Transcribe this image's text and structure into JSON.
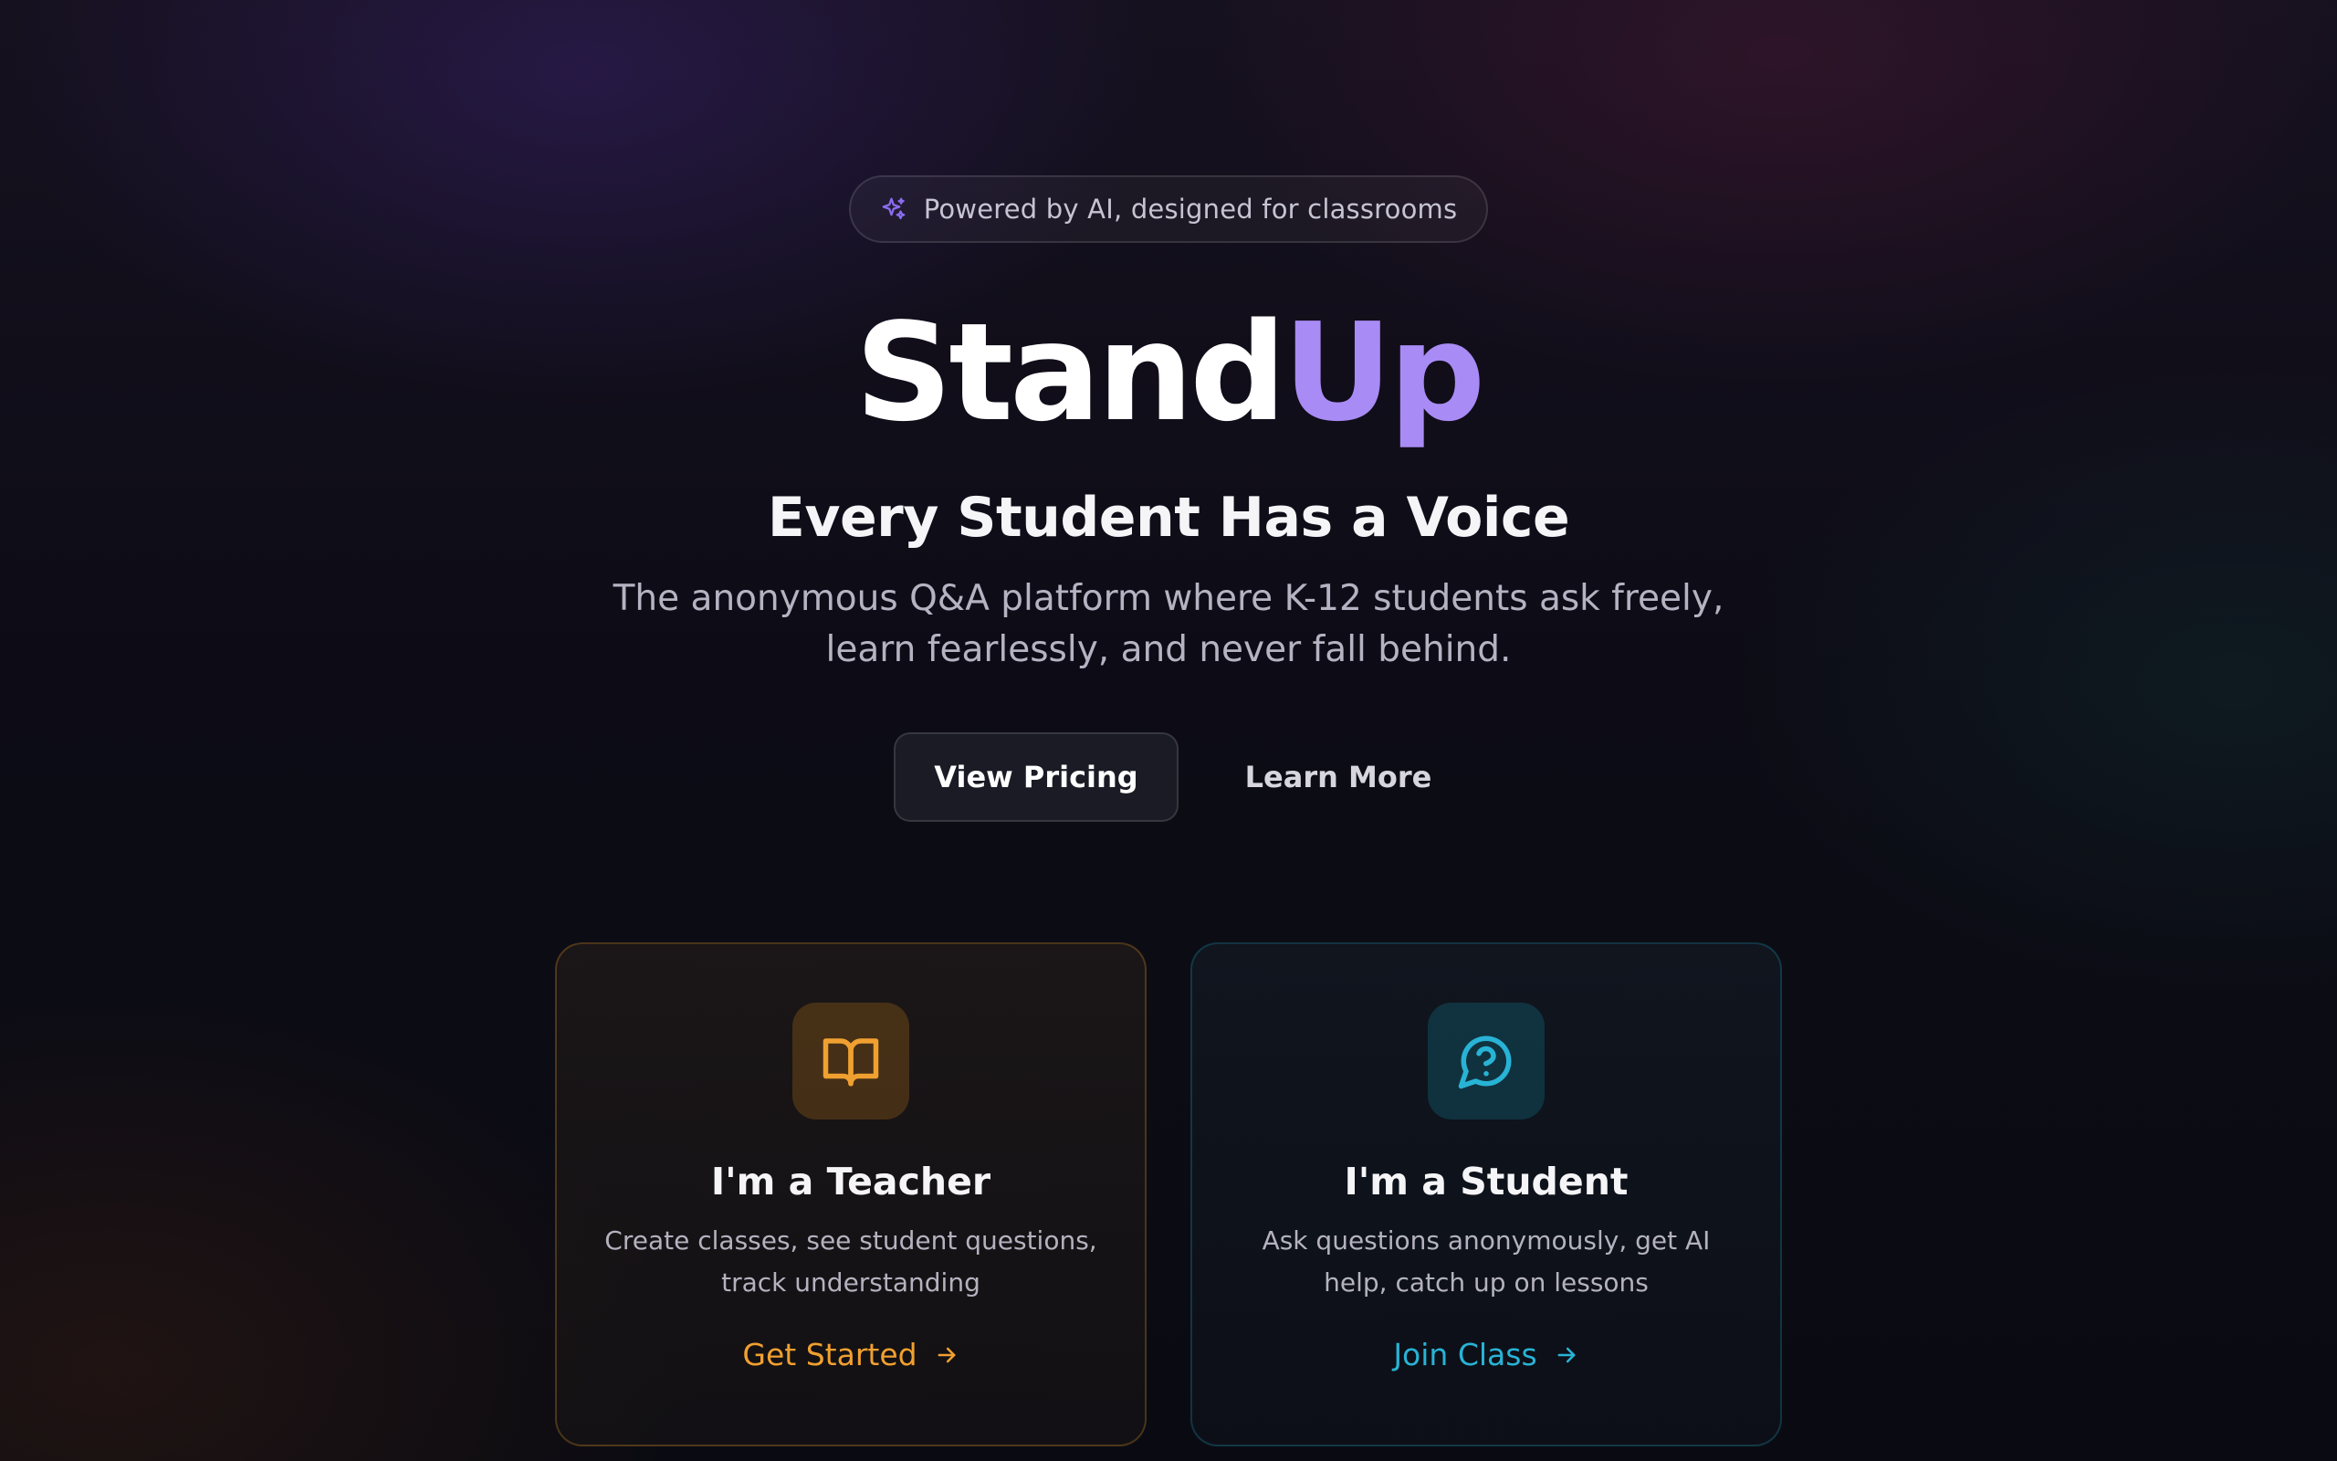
{
  "badge": {
    "text": "Powered by AI, designed for classrooms",
    "icon": "sparkles-icon",
    "icon_color": "#8b6cf0"
  },
  "brand": {
    "part1": "Stand",
    "part2": "Up",
    "accent_color": "#a98bf5"
  },
  "hero": {
    "tagline": "Every Student Has a Voice",
    "subtitle": "The anonymous Q&A platform where K-12 students ask freely, learn fearlessly, and never fall behind."
  },
  "cta": {
    "primary_label": "View Pricing",
    "secondary_label": "Learn More"
  },
  "cards": {
    "teacher": {
      "icon": "book-open-icon",
      "title": "I'm a Teacher",
      "description": "Create classes, see student questions, track understanding",
      "link_label": "Get Started",
      "accent_color": "#f0a030"
    },
    "student": {
      "icon": "message-question-icon",
      "title": "I'm a Student",
      "description": "Ask questions anonymously, get AI help, catch up on lessons",
      "link_label": "Join Class",
      "accent_color": "#28b3d6"
    }
  }
}
